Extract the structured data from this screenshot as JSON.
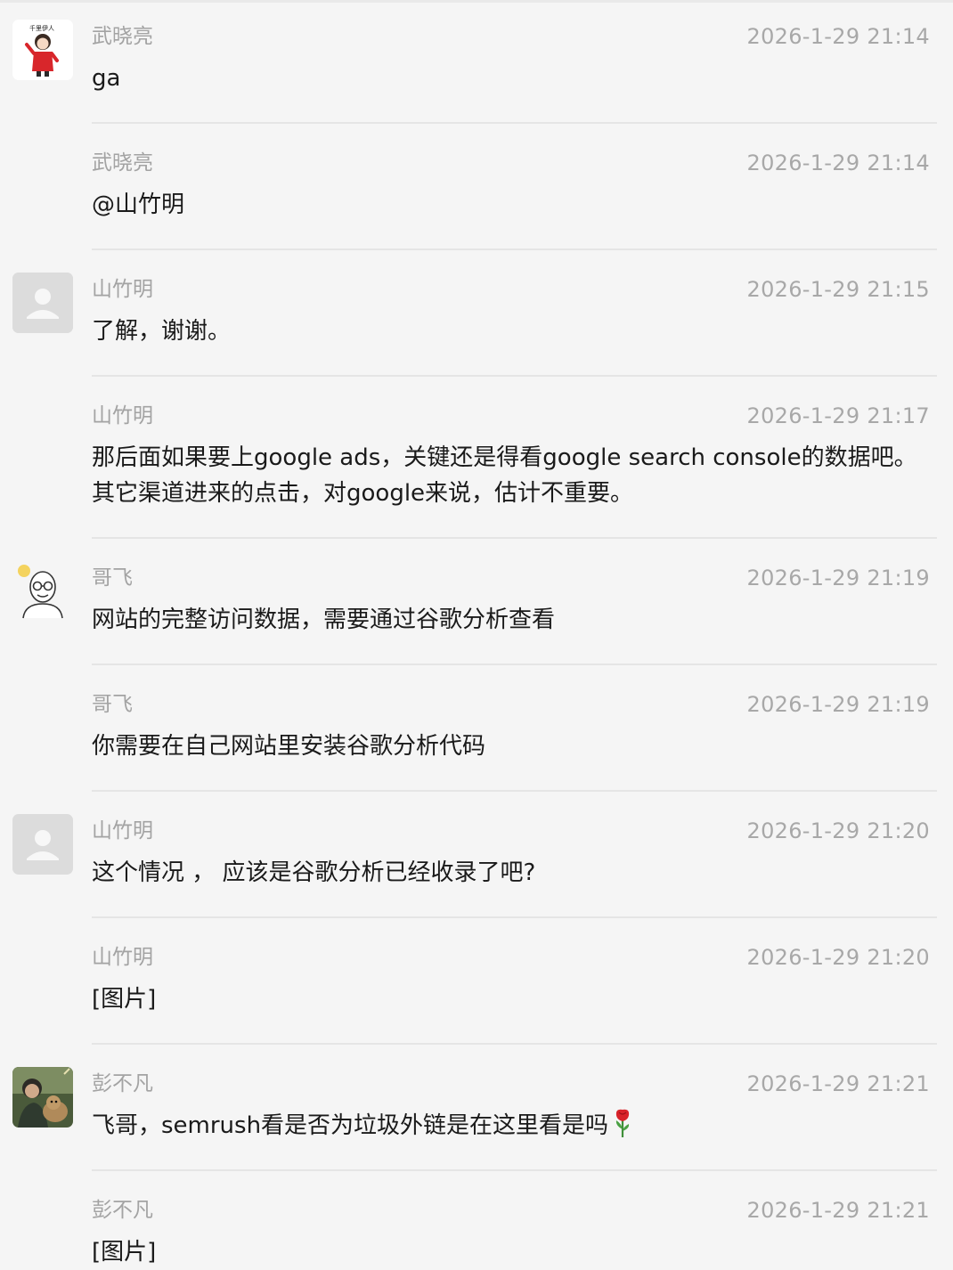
{
  "messages": [
    {
      "name": "武晓亮",
      "time": "2026-1-29 21:14",
      "text": "ga",
      "avatar": "cartoon-red-figure-avatar"
    },
    {
      "name": "武晓亮",
      "time": "2026-1-29 21:14",
      "text": "@山竹明"
    },
    {
      "name": "山竹明",
      "time": "2026-1-29 21:15",
      "text": "了解，谢谢。",
      "avatar": "default-person-avatar"
    },
    {
      "name": "山竹明",
      "time": "2026-1-29 21:17",
      "text": "那后面如果要上google ads，关键还是得看google search console的数据吧。其它渠道进来的点击，对google来说，估计不重要。"
    },
    {
      "name": "哥飞",
      "time": "2026-1-29 21:19",
      "text": "网站的完整访问数据，需要通过谷歌分析查看",
      "avatar": "bald-glasses-man-avatar"
    },
    {
      "name": "哥飞",
      "time": "2026-1-29 21:19",
      "text": "你需要在自己网站里安装谷歌分析代码"
    },
    {
      "name": "山竹明",
      "time": "2026-1-29 21:20",
      "text": "这个情况 ， 应该是谷歌分析已经收录了吧?",
      "avatar": "default-person-avatar"
    },
    {
      "name": "山竹明",
      "time": "2026-1-29 21:20",
      "text": "[图片]"
    },
    {
      "name": "彭不凡",
      "time": "2026-1-29 21:21",
      "text": "飞哥，semrush看是否为垃圾外链是在这里看是吗",
      "avatar": "photo-person-with-dog-avatar",
      "emoji": "rose-icon"
    },
    {
      "name": "彭不凡",
      "time": "2026-1-29 21:21",
      "text": "[图片]"
    }
  ],
  "colors": {
    "background": "#f5f5f5",
    "name": "#a3a3a3",
    "time": "#a8a8a8",
    "text": "#1a1a1a",
    "divider": "#e5e5e5"
  }
}
